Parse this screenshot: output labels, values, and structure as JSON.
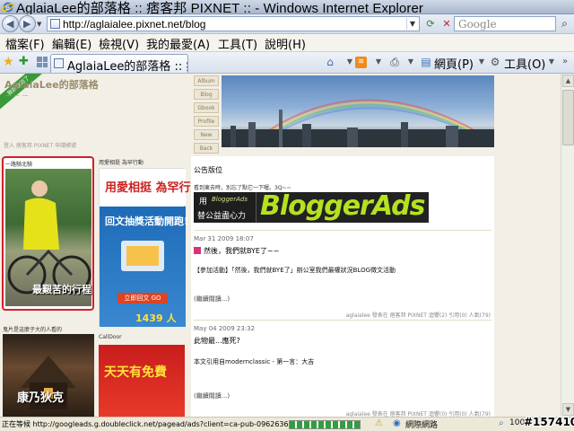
{
  "window": {
    "title": "AglaiaLee的部落格 :: 痞客邦 PIXNET :: - Windows Internet Explorer"
  },
  "address": {
    "url": "http://aglaialee.pixnet.net/blog",
    "search_placeholder": "Google"
  },
  "menu": [
    "檔案(F)",
    "編輯(E)",
    "檢視(V)",
    "我的最愛(A)",
    "工具(T)",
    "說明(H)"
  ],
  "tabbar": {
    "tab_title": "AglaiaLee的部落格 :: 痞...",
    "page_label": "網頁(P)",
    "tools_label": "工具(O)"
  },
  "blog": {
    "title": "AglaiaLee的部落格",
    "ribbon": "我該收到了",
    "login_line": "登入 痞客邦 PIXNET 申請帳號",
    "nav_tabs": [
      "Album",
      "Blog",
      "Gbook",
      "Profile",
      "New",
      "Back"
    ]
  },
  "sidebar_left": {
    "section1_label": "一路騎北騎",
    "section1_caption": "最艱苦的行程",
    "section2_label": "鬼片是這麼子大的人看的",
    "section2_caption": "康乃狄克"
  },
  "sidebar_mid": {
    "label1": "用愛相挺 為罕行動",
    "ad1_top": "用愛相挺 為罕行動",
    "ad1_heading": "回文抽獎活動開跑!",
    "ad1_button": "立即回文 GO",
    "ad1_count": "1439 人",
    "label2": "CallDoor",
    "ad2_heading": "天天有免費"
  },
  "main": {
    "section_heading": "公告版位",
    "note": "看到東去時，別忘了點它一下喔。3Q~~",
    "bloggerads": {
      "line1": "用",
      "line1b": "BloggerAds",
      "line2": "替公益盡心力",
      "logo": "BloggerAds"
    },
    "posts": [
      {
        "date": "Mar 31 2009 18:07",
        "title": "然後，我們就BYE了~~",
        "body": "【參加活動】「然後，我們就BYE了」辦公室我們最權狀況BLOG徵文活動",
        "more": "(繼續閱讀...)",
        "meta": "aglaialee 發表在 痞客邦 PIXNET 迴響(2) 引用(0) 人氣(79)"
      },
      {
        "date": "May 04 2009 23:32",
        "title": "此物最...應死?",
        "body": "本文引用自modernclassic - 第一言：大吉",
        "more": "(繼續閱讀...)",
        "meta": "aglaialee 發表在 痞客邦 PIXNET 迴響(0) 引用(0) 人氣(79)"
      }
    ]
  },
  "status": {
    "text": "正在等候 http://googleads.g.doubleclick.net/pagead/ads?client=ca-pub-0962636423288337&host=p",
    "progress": 1.0,
    "zone": "網際網路",
    "zoom": "100%"
  },
  "watermark": "#157410",
  "colors": {
    "accent_red": "#d0202b",
    "bloggerads_green": "#b5e21f",
    "page_bg": "#f2efe6"
  }
}
